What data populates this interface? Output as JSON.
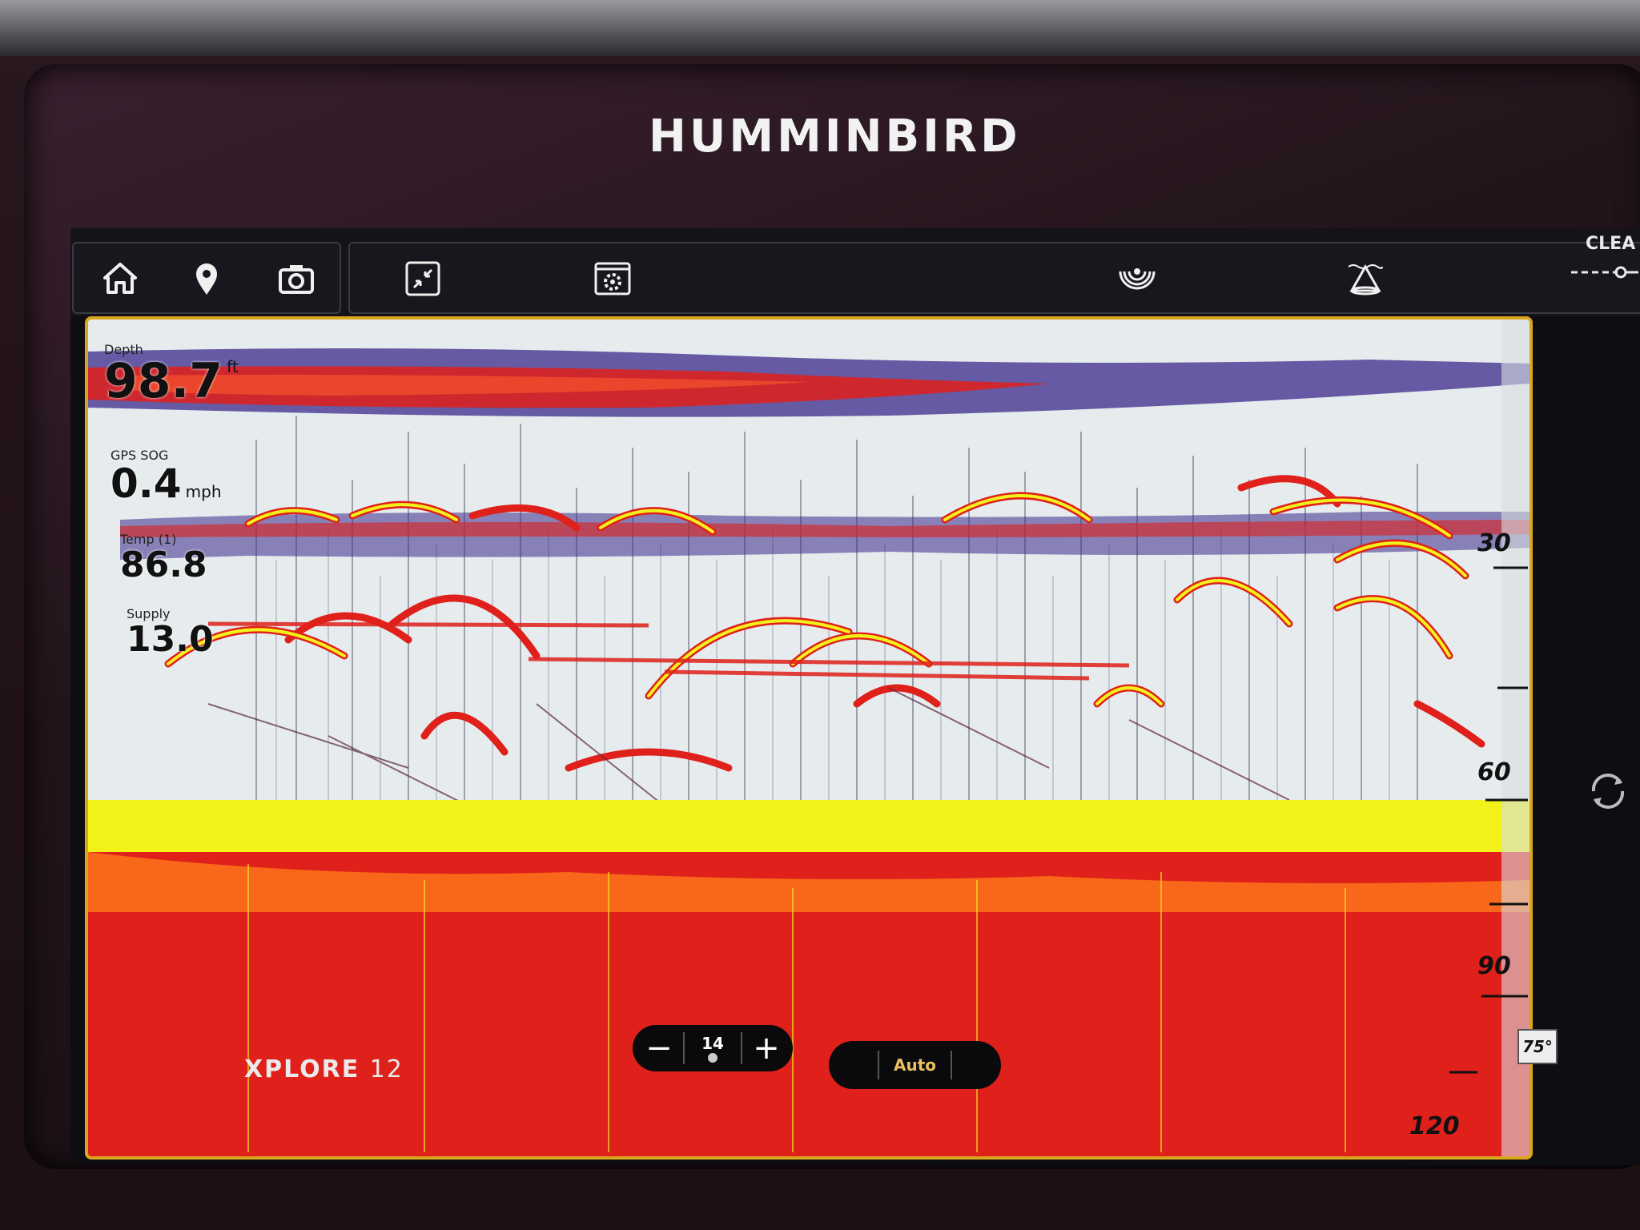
{
  "device": {
    "brand": "HUMMINBIRD",
    "model_name": "XPLORE",
    "model_number": "12"
  },
  "toolbar": {
    "buttons": [
      {
        "id": "home",
        "icon": "home-icon"
      },
      {
        "id": "waypoint",
        "icon": "map-pin-icon"
      },
      {
        "id": "screenshot",
        "icon": "camera-icon"
      },
      {
        "id": "minimize",
        "icon": "shrink-icon"
      },
      {
        "id": "settings",
        "icon": "gear-window-icon"
      },
      {
        "id": "sonar",
        "icon": "sonar-waves-icon"
      },
      {
        "id": "down-imaging",
        "icon": "cone-icon"
      }
    ],
    "clear_label": "CLEA"
  },
  "readouts": {
    "depth": {
      "label": "Depth",
      "value": "98.7",
      "unit": "ft"
    },
    "gps_sog": {
      "label": "GPS SOG",
      "value": "0.4",
      "unit": "mph"
    },
    "temp": {
      "label": "Temp (1)",
      "value": "86.8",
      "unit": ""
    },
    "supply": {
      "label": "Supply",
      "value": "13.0",
      "unit": ""
    }
  },
  "depth_scale": {
    "ticks": [
      "30",
      "60",
      "90",
      "120"
    ]
  },
  "controls": {
    "sensitivity_value": "14",
    "minus_label": "−",
    "plus_label": "+",
    "mode_label": "Auto"
  },
  "range_badge": "75°",
  "colors": {
    "bezel": "#1c1012",
    "frame_accent": "#d9a61e",
    "water": "#e6ecee",
    "sonar_red": "#e0201a",
    "sonar_yellow": "#f2f21a",
    "sonar_purple": "#3a2a8a"
  }
}
